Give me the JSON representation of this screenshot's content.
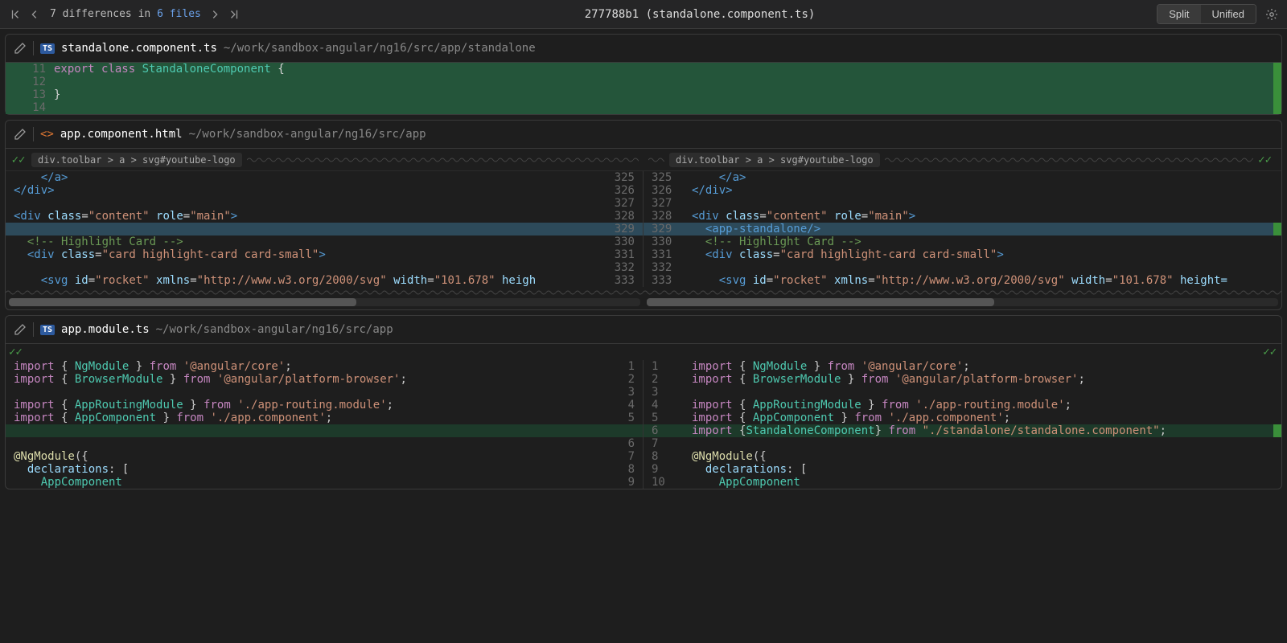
{
  "header": {
    "diff_count_prefix": "7",
    "diff_count_mid": " differences in ",
    "diff_count_files": "6 files",
    "title": "277788b1 (standalone.component.ts)",
    "split": "Split",
    "unified": "Unified"
  },
  "file1": {
    "name": "standalone.component.ts",
    "path": "~/work/sandbox-angular/ng16/src/app/standalone",
    "badge": "TS",
    "rows": [
      {
        "ln": "11",
        "html": "<span class='kw'>export</span> <span class='kw'>class</span> <span class='type'>StandaloneComponent</span> <span class='punct'>{</span>",
        "cls": "row-added-strong"
      },
      {
        "ln": "12",
        "html": "",
        "cls": "row-added-strong"
      },
      {
        "ln": "13",
        "html": "<span class='punct'>}</span>",
        "cls": "row-added-strong"
      },
      {
        "ln": "14",
        "html": "",
        "cls": "row-added-strong"
      }
    ]
  },
  "file2": {
    "name": "app.component.html",
    "path": "~/work/sandbox-angular/ng16/src/app",
    "breadcrumb": "div.toolbar > a > svg#youtube-logo",
    "left": [
      {
        "ln": "",
        "rn": "325",
        "html": "    <span class='tag'>&lt;/a&gt;</span>"
      },
      {
        "ln": "",
        "rn": "326",
        "html": "<span class='tag'>&lt;/div&gt;</span>"
      },
      {
        "ln": "",
        "rn": "327",
        "html": ""
      },
      {
        "ln": "",
        "rn": "328",
        "html": "<span class='tag'>&lt;div</span> <span class='attr'>class</span>=<span class='str'>\"content\"</span> <span class='attr'>role</span>=<span class='str'>\"main\"</span><span class='tag'>&gt;</span>"
      },
      {
        "ln": "",
        "rn": "329",
        "html": "",
        "cls": "row-changed"
      },
      {
        "ln": "",
        "rn": "330",
        "html": "  <span class='cmt'>&lt;!-- Highlight Card --&gt;</span>"
      },
      {
        "ln": "",
        "rn": "331",
        "html": "  <span class='tag'>&lt;div</span> <span class='attr'>class</span>=<span class='str'>\"card highlight-card card-small\"</span><span class='tag'>&gt;</span>"
      },
      {
        "ln": "",
        "rn": "332",
        "html": ""
      },
      {
        "ln": "",
        "rn": "333",
        "html": "    <span class='tag'>&lt;svg</span> <span class='attr'>id</span>=<span class='str'>\"rocket\"</span> <span class='attr'>xmlns</span>=<span class='str'>\"http://www.w3.org/2000/svg\"</span> <span class='attr'>width</span>=<span class='str'>\"101.678\"</span> <span class='attr'>heigh</span>"
      }
    ],
    "right": [
      {
        "ln": "325",
        "html": "    <span class='tag'>&lt;/a&gt;</span>"
      },
      {
        "ln": "326",
        "html": "<span class='tag'>&lt;/div&gt;</span>"
      },
      {
        "ln": "327",
        "html": ""
      },
      {
        "ln": "328",
        "html": "<span class='tag'>&lt;div</span> <span class='attr'>class</span>=<span class='str'>\"content\"</span> <span class='attr'>role</span>=<span class='str'>\"main\"</span><span class='tag'>&gt;</span>"
      },
      {
        "ln": "329",
        "html": "  <span class='tag'>&lt;app-standalone/&gt;</span>",
        "cls": "row-changed"
      },
      {
        "ln": "330",
        "html": "  <span class='cmt'>&lt;!-- Highlight Card --&gt;</span>"
      },
      {
        "ln": "331",
        "html": "  <span class='tag'>&lt;div</span> <span class='attr'>class</span>=<span class='str'>\"card highlight-card card-small\"</span><span class='tag'>&gt;</span>"
      },
      {
        "ln": "332",
        "html": ""
      },
      {
        "ln": "333",
        "html": "    <span class='tag'>&lt;svg</span> <span class='attr'>id</span>=<span class='str'>\"rocket\"</span> <span class='attr'>xmlns</span>=<span class='str'>\"http://www.w3.org/2000/svg\"</span> <span class='attr'>width</span>=<span class='str'>\"101.678\"</span> <span class='attr'>height=</span>"
      }
    ]
  },
  "file3": {
    "name": "app.module.ts",
    "path": "~/work/sandbox-angular/ng16/src/app",
    "badge": "TS",
    "left": [
      {
        "rn": "1",
        "html": "<span class='kw'>import</span> { <span class='type'>NgModule</span> } <span class='kw'>from</span> <span class='str'>'@angular/core'</span>;"
      },
      {
        "rn": "2",
        "html": "<span class='kw'>import</span> { <span class='type'>BrowserModule</span> } <span class='kw'>from</span> <span class='str'>'@angular/platform-browser'</span>;"
      },
      {
        "rn": "3",
        "html": ""
      },
      {
        "rn": "4",
        "html": "<span class='kw'>import</span> { <span class='type'>AppRoutingModule</span> } <span class='kw'>from</span> <span class='str'>'./app-routing.module'</span>;"
      },
      {
        "rn": "5",
        "html": "<span class='kw'>import</span> { <span class='type'>AppComponent</span> } <span class='kw'>from</span> <span class='str'>'./app.component'</span>;"
      },
      {
        "rn": "",
        "html": "",
        "cls": "row-added"
      },
      {
        "rn": "6",
        "html": ""
      },
      {
        "rn": "7",
        "html": "<span class='decl'>@NgModule</span>({"
      },
      {
        "rn": "8",
        "html": "  <span class='attr'>declarations</span>: ["
      },
      {
        "rn": "9",
        "html": "    <span class='type'>AppComponent</span>"
      }
    ],
    "right": [
      {
        "ln": "1",
        "html": "<span class='kw'>import</span> { <span class='type'>NgModule</span> } <span class='kw'>from</span> <span class='str'>'@angular/core'</span>;"
      },
      {
        "ln": "2",
        "html": "<span class='kw'>import</span> { <span class='type'>BrowserModule</span> } <span class='kw'>from</span> <span class='str'>'@angular/platform-browser'</span>;"
      },
      {
        "ln": "3",
        "html": ""
      },
      {
        "ln": "4",
        "html": "<span class='kw'>import</span> { <span class='type'>AppRoutingModule</span> } <span class='kw'>from</span> <span class='str'>'./app-routing.module'</span>;"
      },
      {
        "ln": "5",
        "html": "<span class='kw'>import</span> { <span class='type'>AppComponent</span> } <span class='kw'>from</span> <span class='str'>'./app.component'</span>;"
      },
      {
        "ln": "6",
        "html": "<span class='kw'>import</span> {<span class='type'>StandaloneComponent</span>} <span class='kw'>from</span> <span class='str'>\"./standalone/standalone.component\"</span>;",
        "cls": "row-added"
      },
      {
        "ln": "7",
        "html": ""
      },
      {
        "ln": "8",
        "html": "<span class='decl'>@NgModule</span>({"
      },
      {
        "ln": "9",
        "html": "  <span class='attr'>declarations</span>: ["
      },
      {
        "ln": "10",
        "html": "    <span class='type'>AppComponent</span>"
      }
    ]
  }
}
